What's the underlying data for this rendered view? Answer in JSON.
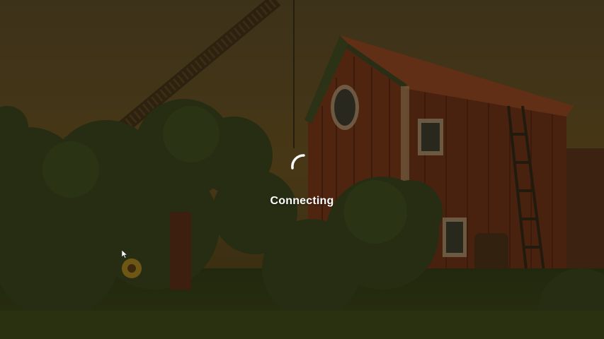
{
  "loading": {
    "status_text": "Connecting",
    "spinner_icon": "loading-spinner-icon"
  },
  "colors": {
    "overlay": "#14100880",
    "text": "#ffffff",
    "sky": "#6b5523",
    "barn_red": "#8a3a1f",
    "roof": "#a24a25",
    "foliage": "#3c4a1e"
  },
  "cursor_icon": "mouse-pointer-icon"
}
